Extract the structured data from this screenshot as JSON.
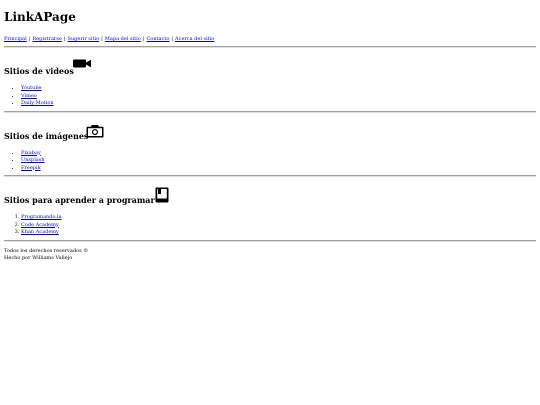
{
  "header": {
    "title": "LinkAPage"
  },
  "nav": {
    "items": [
      {
        "label": "Principal"
      },
      {
        "label": "Registrarse"
      },
      {
        "label": "Sugerir sitio"
      },
      {
        "label": "Mapa del sitio"
      },
      {
        "label": "Contacto"
      },
      {
        "label": "Acerca del sitio"
      }
    ],
    "separator": "|"
  },
  "sections": {
    "videos": {
      "title": "Sitios de videos",
      "icon": "video-camera-icon",
      "links": [
        "Youtube",
        "Vimeo",
        "Daily Motion"
      ]
    },
    "images": {
      "title": "Sitios de imágenes",
      "icon": "camera-icon",
      "links": [
        "Pixabay",
        "Unsplash",
        "Freepik"
      ]
    },
    "programming": {
      "title": "Sitios para aprender a programar",
      "icon": "book-icon",
      "links": [
        "Programando.la",
        "Code Academy",
        "Khan Academy"
      ]
    }
  },
  "footer": {
    "line1": "Todos los derechos reservados ©",
    "line2": "Hecho por Williams Vallejo"
  }
}
